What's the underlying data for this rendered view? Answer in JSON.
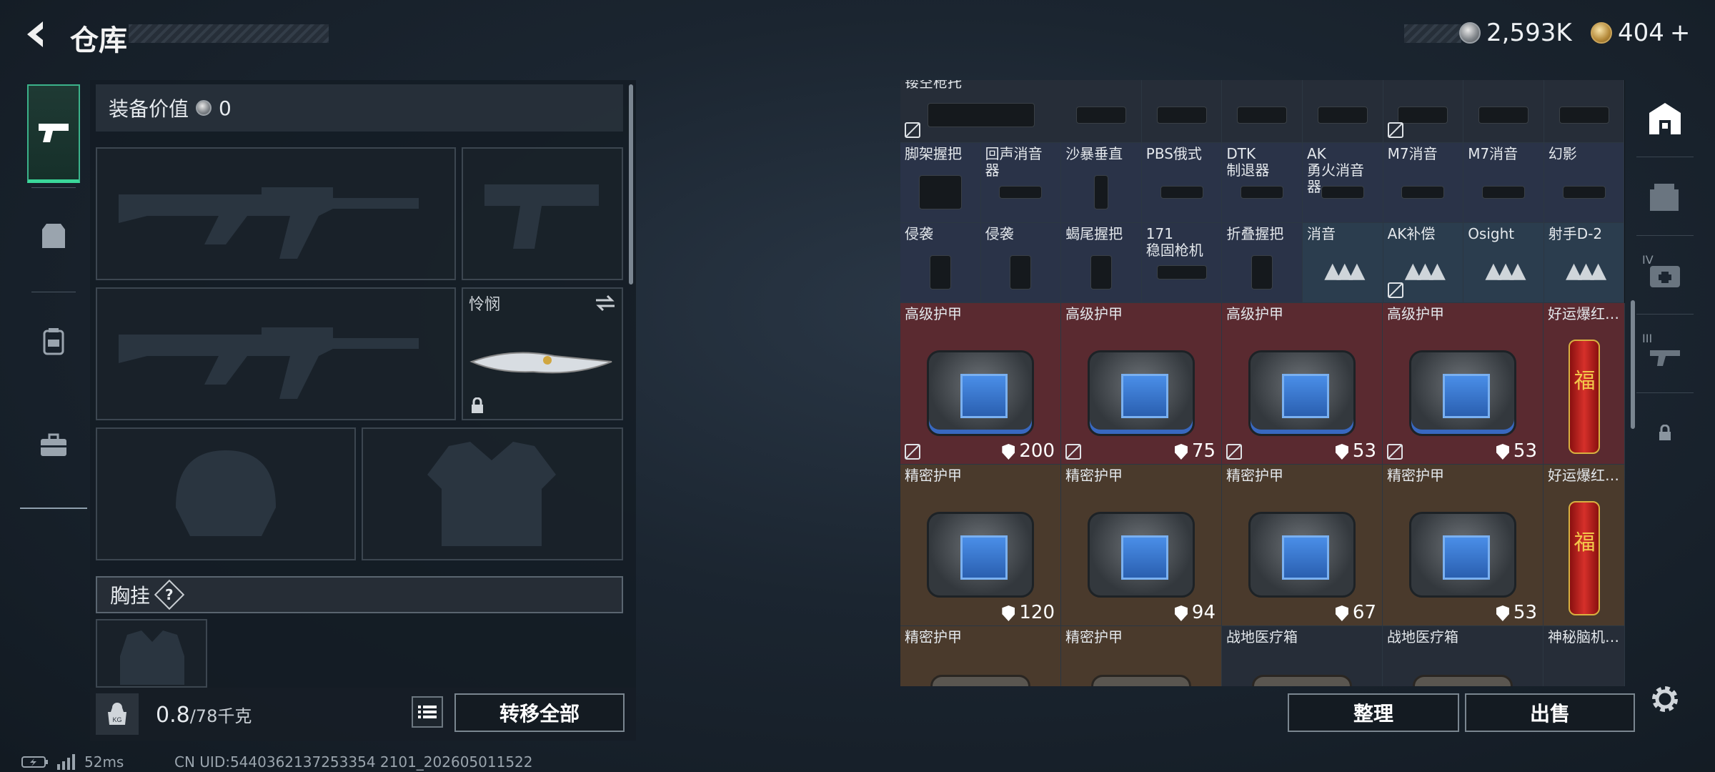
{
  "header": {
    "title": "仓库",
    "currency_silver": "2,593K",
    "currency_gold": "404",
    "currency_add": "+"
  },
  "equipment": {
    "value_label": "装备价值",
    "value": "0",
    "melee_name": "怜悯",
    "chest_label": "胸挂",
    "chest_help": "?"
  },
  "footer_left": {
    "weight": "0.8",
    "capacity": "/78千克",
    "kg_icon_label": "KG",
    "transfer_all": "转移全部"
  },
  "footer_right": {
    "sort": "整理",
    "sell": "出售"
  },
  "status": {
    "ping": "52ms",
    "uid": "CN UID:5440362137253354 2101_202605011522"
  },
  "storage": {
    "row0": [
      "镂空枪托",
      "",
      "",
      "",
      "",
      "",
      ""
    ],
    "row1": [
      "脚架握把",
      "回声消音器",
      "沙暴垂直",
      "PBS俄式",
      "DTK\n制退器",
      "AK\n勇火消音器",
      "M7消音",
      "M7消音",
      "幻影"
    ],
    "row2": [
      "侵袭",
      "侵袭",
      "蝎尾握把",
      "171\n稳固枪机",
      "折叠握把",
      "消音",
      "AK补偿",
      "Osight",
      "射手D-2"
    ],
    "row3": [
      {
        "name": "高级护甲",
        "dur": "200"
      },
      {
        "name": "高级护甲",
        "dur": "75"
      },
      {
        "name": "高级护甲",
        "dur": "53"
      },
      {
        "name": "高级护甲",
        "dur": "53"
      },
      {
        "name": "好运爆红…",
        "dur": ""
      }
    ],
    "row4": [
      {
        "name": "精密护甲",
        "dur": "120"
      },
      {
        "name": "精密护甲",
        "dur": "94"
      },
      {
        "name": "精密护甲",
        "dur": "67"
      },
      {
        "name": "精密护甲",
        "dur": "53"
      },
      {
        "name": "好运爆红…",
        "dur": ""
      }
    ],
    "row5": [
      "精密护甲",
      "精密护甲",
      "战地医疗箱",
      "战地医疗箱",
      "神秘脑机…"
    ]
  },
  "right_nav": [
    "IV",
    "III"
  ]
}
